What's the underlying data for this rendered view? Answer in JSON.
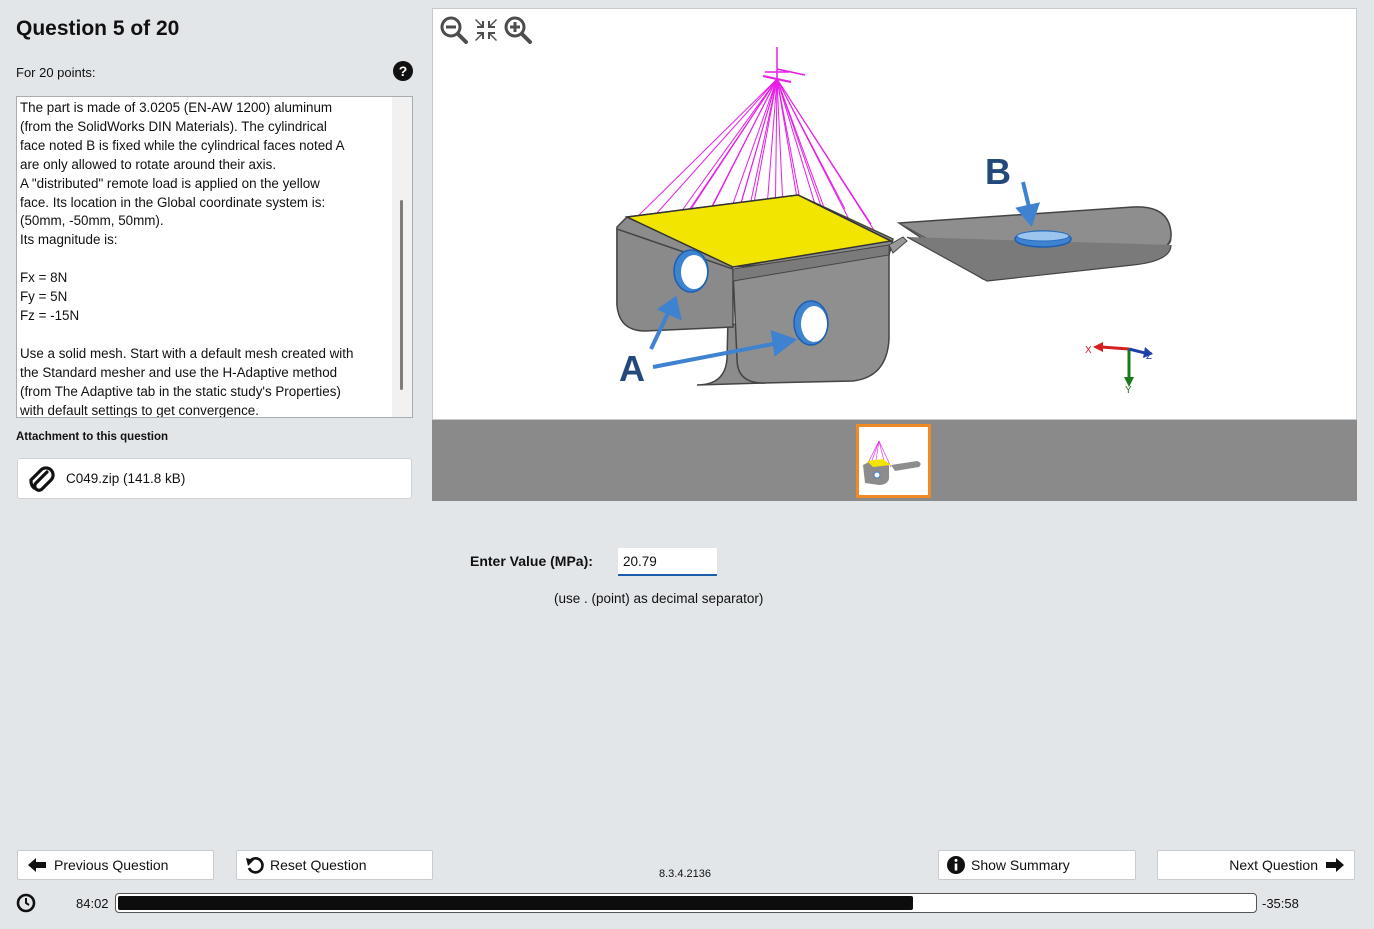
{
  "header": {
    "title": "Question 5 of 20",
    "points": "For 20 points:"
  },
  "question": {
    "text": "The part is made of 3.0205 (EN-AW 1200) aluminum\n(from the SolidWorks DIN Materials). The cylindrical\nface noted B is fixed while the cylindrical faces noted A\nare only allowed to rotate around their axis.\nA \"distributed\" remote load is applied on the yellow\nface. Its location in the Global coordinate system is:\n(50mm, -50mm, 50mm).\nIts magnitude is:\n\nFx = 8N\nFy = 5N\nFz = -15N\n\nUse a solid mesh. Start with a default mesh created with\nthe Standard mesher and use the H-Adaptive method\n(from The Adaptive tab in the static study's Properties)\nwith default settings to get convergence."
  },
  "attachment": {
    "label": "Attachment to this question",
    "file": "C049.zip (141.8 kB)"
  },
  "figure": {
    "label_a": "A",
    "label_b": "B",
    "axis_x": "X",
    "axis_y": "Y",
    "axis_z": "Z"
  },
  "answer": {
    "label": "Enter Value (MPa):",
    "value": "20.79",
    "hint": "(use . (point) as decimal separator)"
  },
  "footer": {
    "prev": "Previous Question",
    "reset": "Reset Question",
    "version": "8.3.4.2136",
    "summary": "Show Summary",
    "next": "Next Question",
    "elapsed": "84:02",
    "remaining": "-35:58",
    "progress_fraction": 0.701
  },
  "colors": {
    "accent": "#1b5fa8",
    "thumb_border": "#f08a24",
    "load_lines": "#e61ee6",
    "load_face": "#f2e600",
    "part": "#8c8c8c",
    "arrow": "#3f82cf"
  }
}
